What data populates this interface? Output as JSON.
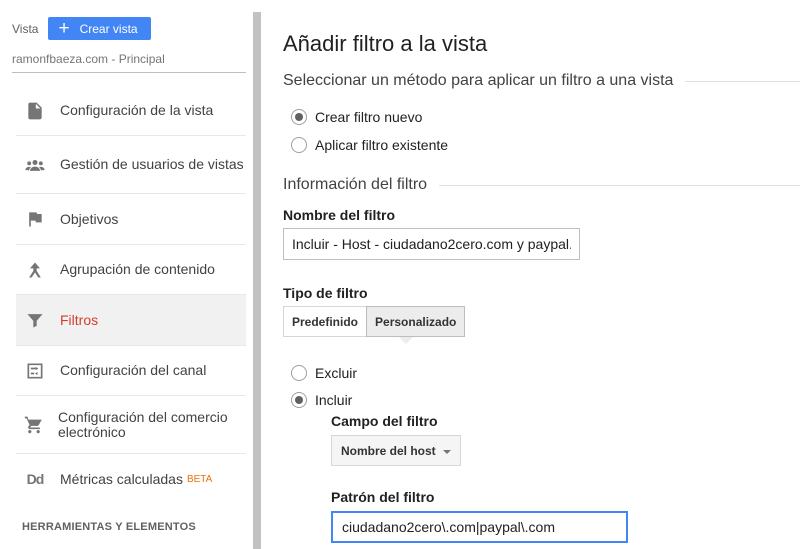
{
  "sidebar": {
    "view_label": "Vista",
    "create_view_label": "Crear vista",
    "view_selected": "ramonfbaeza.com - Principal",
    "items": [
      {
        "label": "Configuración de la vista",
        "icon": "document-icon"
      },
      {
        "label": "Gestión de usuarios de vistas",
        "icon": "users-icon"
      },
      {
        "label": "Objetivos",
        "icon": "flag-icon"
      },
      {
        "label": "Agrupación de contenido",
        "icon": "content-grouping-icon"
      },
      {
        "label": "Filtros",
        "icon": "filter-icon",
        "active": true
      },
      {
        "label": "Configuración del canal",
        "icon": "channel-settings-icon"
      },
      {
        "label": "Configuración del comercio electrónico",
        "icon": "shopping-cart-icon"
      },
      {
        "label": "Métricas calculadas",
        "icon": "calculated-metrics-icon",
        "badge": "BETA",
        "icon_text": "Dd"
      }
    ],
    "tools_header": "HERRAMIENTAS Y ELEMENTOS"
  },
  "main": {
    "title": "Añadir filtro a la vista",
    "method_section": "Seleccionar un método para aplicar un filtro a una vista",
    "method_options": [
      {
        "label": "Crear filtro nuevo",
        "checked": true
      },
      {
        "label": "Aplicar filtro existente",
        "checked": false
      }
    ],
    "info_section": "Información del filtro",
    "filter_name_label": "Nombre del filtro",
    "filter_name_value": "Incluir - Host - ciudadano2cero.com y paypal.",
    "filter_type_label": "Tipo de filtro",
    "filter_type_tabs": [
      {
        "label": "Predefinido",
        "active": false
      },
      {
        "label": "Personalizado",
        "active": true
      }
    ],
    "mode_options": [
      {
        "label": "Excluir",
        "checked": false
      },
      {
        "label": "Incluir",
        "checked": true
      }
    ],
    "filter_field_label": "Campo del filtro",
    "filter_field_value": "Nombre del host",
    "filter_pattern_label": "Patrón del filtro",
    "filter_pattern_value": "ciudadano2cero\\.com|paypal\\.com"
  },
  "colors": {
    "accent": "#4285f4",
    "active_nav": "#d23f31",
    "beta": "#e8710a"
  }
}
